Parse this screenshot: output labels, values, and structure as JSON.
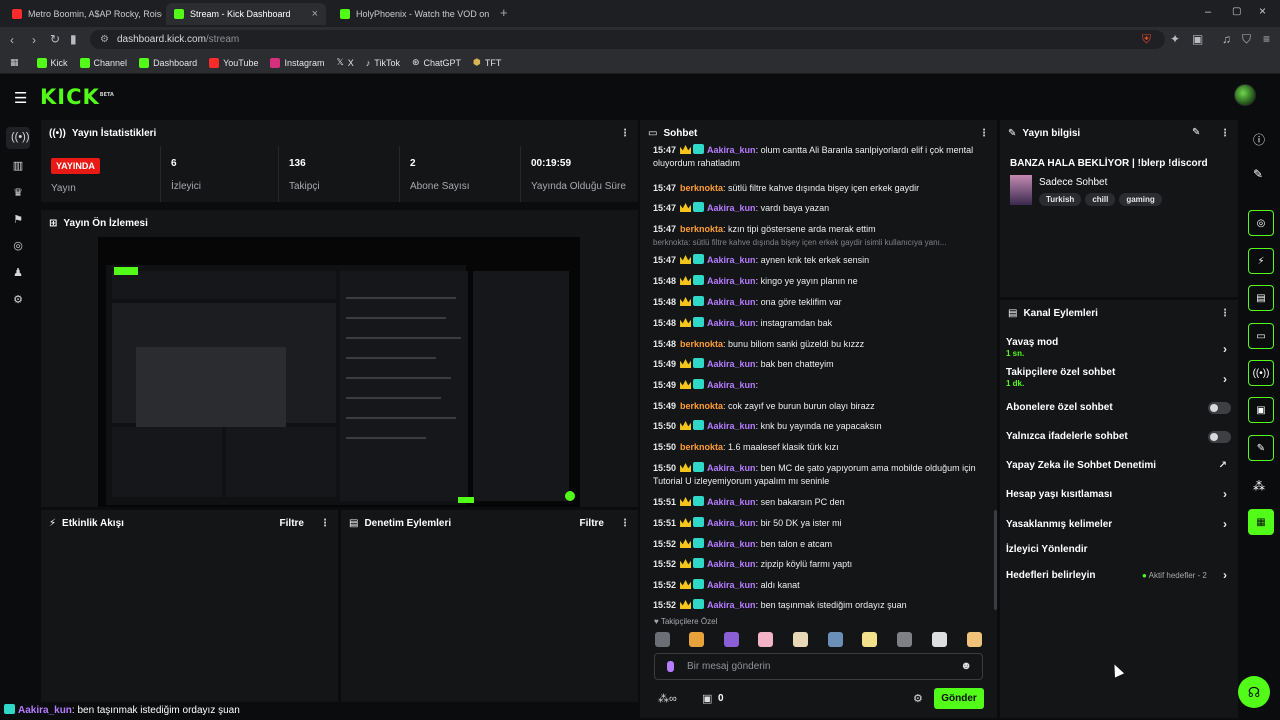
{
  "browser": {
    "tabs": [
      {
        "title": "Metro Boomin, A$AP Rocky, Roisee",
        "icon": "youtube-icon"
      },
      {
        "title": "Stream - Kick Dashboard",
        "icon": "kick-icon"
      },
      {
        "title": "HolyPhoenix - Watch the VOD on Kick",
        "icon": "kick-icon"
      }
    ],
    "url_host": "dashboard.kick.com",
    "url_path": "/stream",
    "bookmarks": [
      "Kick",
      "Channel",
      "Dashboard",
      "YouTube",
      "Instagram",
      "X",
      "TikTok",
      "ChatGPT",
      "TFT"
    ]
  },
  "header": {
    "logo": "KICK",
    "logo_beta": "BETA"
  },
  "stats": {
    "title": "Yayın İstatistikleri",
    "live_badge": "YAYINDA",
    "live_label": "Yayın",
    "viewers_value": "6",
    "viewers_label": "İzleyici",
    "followers_value": "136",
    "followers_label": "Takipçi",
    "subs_value": "2",
    "subs_label": "Abone Sayısı",
    "uptime_value": "00:19:59",
    "uptime_label": "Yayında Olduğu Süre"
  },
  "preview": {
    "title": "Yayın Ön İzlemesi"
  },
  "activity": {
    "title": "Etkinlik Akışı",
    "filter": "Filtre"
  },
  "moderation": {
    "title": "Denetim Eylemleri",
    "filter": "Filtre"
  },
  "chat": {
    "title": "Sohbet",
    "top_partial": "oluyordum rahatladım",
    "top_partial_first": "olum cantta Ali Baranla sanlpiyorlardı elif i çok mental",
    "reply_preview": "berknokta: sütlü filtre kahve dışında bişey içen erkek gaydir isimli kullanıcıya yanı...",
    "messages": [
      {
        "time": "15:47",
        "user": "berknokta",
        "type": "orange",
        "text": "sütlü filtre kahve dışında bişey içen erkek gaydir"
      },
      {
        "time": "15:47",
        "user": "Aakira_kun",
        "type": "purple",
        "text": "vardı baya yazan"
      },
      {
        "time": "15:47",
        "user": "berknokta",
        "type": "orange",
        "text": "kzın tipi göstersene arda merak ettim"
      },
      {
        "time": "15:47",
        "user": "Aakira_kun",
        "type": "purple",
        "text": "aynen knk tek erkek sensin"
      },
      {
        "time": "15:48",
        "user": "Aakira_kun",
        "type": "purple",
        "text": "kingo ye yayın planın ne"
      },
      {
        "time": "15:48",
        "user": "Aakira_kun",
        "type": "purple",
        "text": "ona göre teklifim var"
      },
      {
        "time": "15:48",
        "user": "Aakira_kun",
        "type": "purple",
        "text": "instagramdan bak"
      },
      {
        "time": "15:48",
        "user": "berknokta",
        "type": "orange",
        "text": "bunu biliom sanki güzeldi bu kızzz"
      },
      {
        "time": "15:49",
        "user": "Aakira_kun",
        "type": "purple",
        "text": "bak ben chatteyim"
      },
      {
        "time": "15:49",
        "user": "Aakira_kun",
        "type": "purple",
        "text": ""
      },
      {
        "time": "15:49",
        "user": "berknokta",
        "type": "orange",
        "text": "cok zayıf ve burun burun olayı birazz"
      },
      {
        "time": "15:50",
        "user": "Aakira_kun",
        "type": "purple",
        "text": "knk bu yayında ne yapacaksın"
      },
      {
        "time": "15:50",
        "user": "berknokta",
        "type": "orange",
        "text": "1.6 maalesef klasik türk kızı"
      },
      {
        "time": "15:50",
        "user": "Aakira_kun",
        "type": "purple",
        "text": "ben MC de şato yapıyorum ama mobilde olduğum için Tutorial U izleyemiyorum yapalım mı seninle"
      },
      {
        "time": "15:51",
        "user": "Aakira_kun",
        "type": "purple",
        "text": "sen bakarsın PC den"
      },
      {
        "time": "15:51",
        "user": "Aakira_kun",
        "type": "purple",
        "text": "bir 50 DK ya ister mi"
      },
      {
        "time": "15:52",
        "user": "Aakira_kun",
        "type": "purple",
        "text": "ben talon e atcam"
      },
      {
        "time": "15:52",
        "user": "Aakira_kun",
        "type": "purple",
        "text": "zipzip köylü farmı yaptı"
      },
      {
        "time": "15:52",
        "user": "Aakira_kun",
        "type": "purple",
        "text": "aldı kanat"
      },
      {
        "time": "15:52",
        "user": "Aakira_kun",
        "type": "purple",
        "text": "ben taşınmak istediğim ordayız şuan"
      }
    ],
    "followers_only_label": "Takipçilere Özel",
    "input_placeholder": "Bir mesaj gönderin",
    "points_value": "0",
    "send_label": "Gönder"
  },
  "stream_info": {
    "title_label": "Yayın bilgisi",
    "stream_title": "BANZA HALA BEKLİYOR | !blerp !discord",
    "category": "Sadece Sohbet",
    "tags": [
      "Turkish",
      "chill",
      "gaming"
    ]
  },
  "channel_actions": {
    "title": "Kanal Eylemleri",
    "items": [
      {
        "label": "Yavaş mod",
        "sub": "1 sn."
      },
      {
        "label": "Takipçilere özel sohbet",
        "sub": "1 dk."
      },
      {
        "label": "Abonelere özel sohbet"
      },
      {
        "label": "Yalnızca ifadelerle sohbet"
      },
      {
        "label": "Yapay Zeka ile Sohbet Denetimi"
      },
      {
        "label": "Hesap yaşı kısıtlaması"
      },
      {
        "label": "Yasaklanmış kelimeler"
      },
      {
        "label": "İzleyici Yönlendir"
      },
      {
        "label": "Hedefleri belirleyin",
        "extra": "Aktif hedefler - 2"
      }
    ]
  },
  "bottom_strip": {
    "user": "Aakira_kun",
    "text": ": ben taşınmak istediğim ordayız şuan"
  },
  "colors": {
    "accent": "#53fc18",
    "live": "#e91916",
    "panel": "#141517",
    "bg": "#0b0c0d"
  }
}
